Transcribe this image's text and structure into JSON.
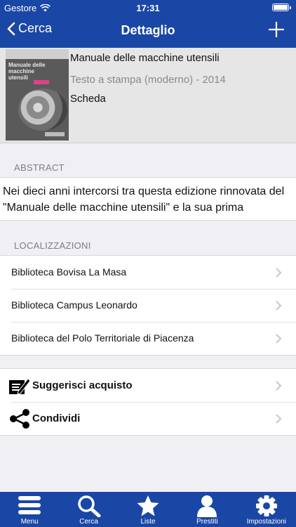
{
  "status_bar": {
    "carrier": "Gestore",
    "time": "17:31"
  },
  "nav": {
    "back_label": "Cerca",
    "title": "Dettaglio"
  },
  "book": {
    "cover_text": "Manuale delle macchine utensili",
    "title": "Manuale delle macchine utensili",
    "type_year": "Testo a stampa (moderno) - 2014",
    "scheda": "Scheda"
  },
  "abstract": {
    "header": "ABSTRACT",
    "text": "Nei dieci anni intercorsi tra questa edizione rinnovata del \"Manuale delle macchine utensili\" e la sua prima"
  },
  "locations": {
    "header": "LOCALIZZAZIONI",
    "items": [
      {
        "label": "Biblioteca Bovisa La Masa"
      },
      {
        "label": "Biblioteca Campus Leonardo"
      },
      {
        "label": "Biblioteca del Polo Territoriale di Piacenza"
      }
    ]
  },
  "actions": {
    "suggest": "Suggerisci acquisto",
    "share": "Condividi"
  },
  "tabs": [
    {
      "label": "Menu",
      "icon": "menu-icon"
    },
    {
      "label": "Cerca",
      "icon": "search-icon"
    },
    {
      "label": "Liste",
      "icon": "star-icon"
    },
    {
      "label": "Prestiti",
      "icon": "person-icon"
    },
    {
      "label": "Impostazioni",
      "icon": "gear-icon"
    }
  ],
  "colors": {
    "accent": "#1a47a6",
    "background": "#efeff4"
  }
}
